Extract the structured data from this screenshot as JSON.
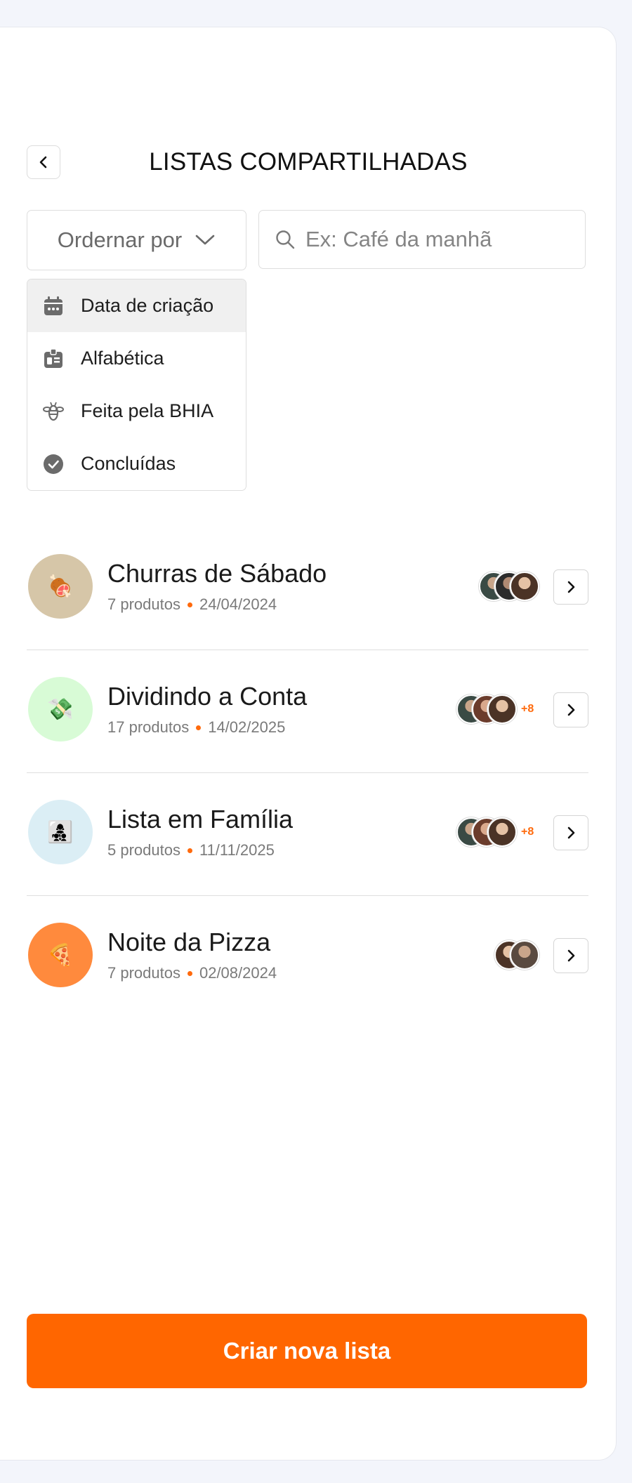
{
  "header": {
    "title": "LISTAS COMPARTILHADAS"
  },
  "sort": {
    "label": "Ordernar por",
    "options": [
      {
        "label": "Data de criação",
        "icon": "calendar-icon",
        "selected": true
      },
      {
        "label": "Alfabética",
        "icon": "id-card-icon",
        "selected": false
      },
      {
        "label": "Feita pela BHIA",
        "icon": "bee-icon",
        "selected": false
      },
      {
        "label": "Concluídas",
        "icon": "check-circle-icon",
        "selected": false
      }
    ]
  },
  "search": {
    "placeholder": "Ex: Café da manhã",
    "value": ""
  },
  "lists": [
    {
      "title": "Churras de Sábado",
      "products": "7 produtos",
      "date": "24/04/2024",
      "emoji": "🍖",
      "thumb_color": "#d6c6a8",
      "extra": ""
    },
    {
      "title": "Dividindo a Conta",
      "products": "17 produtos",
      "date": "14/02/2025",
      "emoji": "💸",
      "thumb_color": "#d8fbd6",
      "extra": "+8"
    },
    {
      "title": "Lista em Família",
      "products": "5 produtos",
      "date": "11/11/2025",
      "emoji": "👩‍👧‍👦",
      "thumb_color": "#dbeef5",
      "extra": "+8"
    },
    {
      "title": "Noite da Pizza",
      "products": "7 produtos",
      "date": "02/08/2024",
      "emoji": "🍕",
      "thumb_color": "#ff8a3d",
      "extra": ""
    }
  ],
  "actions": {
    "create_label": "Criar nova lista"
  },
  "colors": {
    "accent": "#ff6600",
    "background": "#f3f5fb"
  }
}
